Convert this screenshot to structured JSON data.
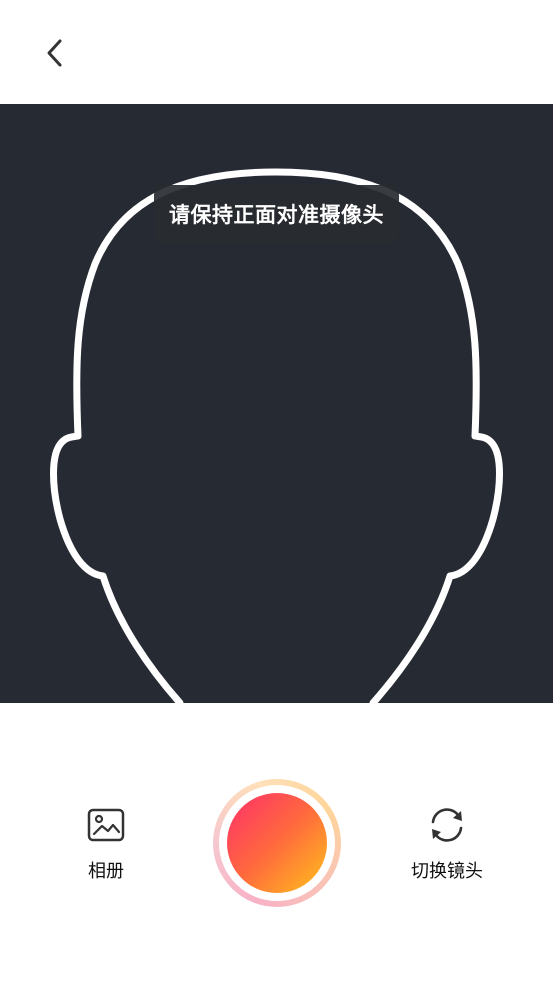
{
  "header": {
    "back_icon": "chevron-left-icon"
  },
  "camera": {
    "hint": "请保持正面对准摄像头",
    "background_color": "#262b33",
    "outline_color": "#ffffff"
  },
  "controls": {
    "album_label": "相册",
    "album_icon": "image-icon",
    "switch_label": "切换镜头",
    "switch_icon": "refresh-camera-icon",
    "shutter_colors": [
      "#ff2f6b",
      "#ff6a3d",
      "#ffc21a"
    ]
  }
}
